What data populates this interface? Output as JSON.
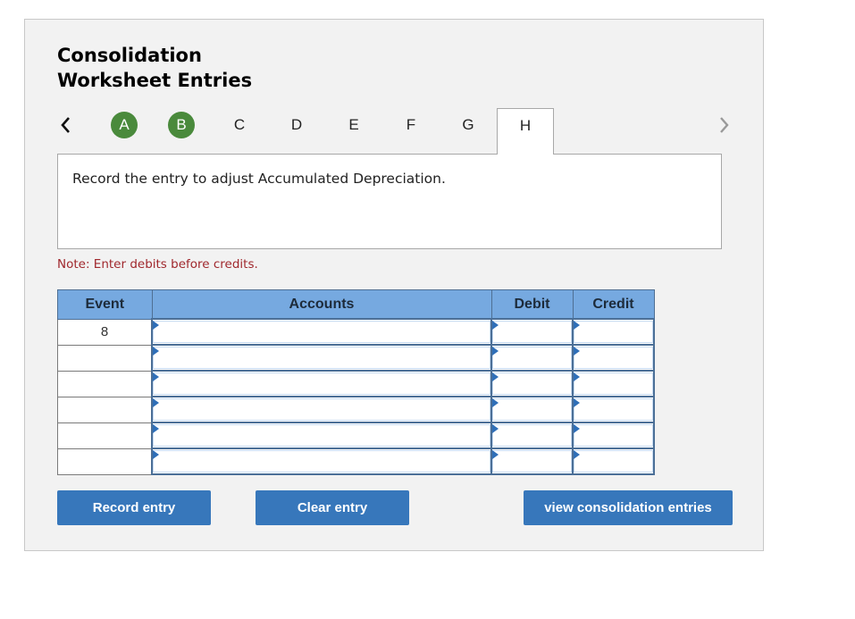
{
  "header": {
    "title_line1": "Consolidation",
    "title_line2": "Worksheet Entries"
  },
  "tabs": {
    "prev_icon": "chevron-left-icon",
    "next_icon": "chevron-right-icon",
    "items": [
      {
        "label": "A",
        "state": "completed"
      },
      {
        "label": "B",
        "state": "completed"
      },
      {
        "label": "C",
        "state": "default"
      },
      {
        "label": "D",
        "state": "default"
      },
      {
        "label": "E",
        "state": "default"
      },
      {
        "label": "F",
        "state": "default"
      },
      {
        "label": "G",
        "state": "default"
      },
      {
        "label": "H",
        "state": "active"
      }
    ]
  },
  "prompt": "Record the entry to adjust Accumulated Depreciation.",
  "note": "Note: Enter debits before credits.",
  "table": {
    "headers": [
      "Event",
      "Accounts",
      "Debit",
      "Credit"
    ],
    "rows": [
      {
        "event": "8",
        "account": "",
        "debit": "",
        "credit": ""
      },
      {
        "event": "",
        "account": "",
        "debit": "",
        "credit": ""
      },
      {
        "event": "",
        "account": "",
        "debit": "",
        "credit": ""
      },
      {
        "event": "",
        "account": "",
        "debit": "",
        "credit": ""
      },
      {
        "event": "",
        "account": "",
        "debit": "",
        "credit": ""
      },
      {
        "event": "",
        "account": "",
        "debit": "",
        "credit": ""
      }
    ]
  },
  "buttons": {
    "record": "Record entry",
    "clear": "Clear entry",
    "view": "view consolidation entries"
  },
  "colors": {
    "completed_tab": "#4a8a3c",
    "header_bg": "#76a9e0",
    "button_bg": "#3777bb",
    "note_text": "#a0282d"
  }
}
